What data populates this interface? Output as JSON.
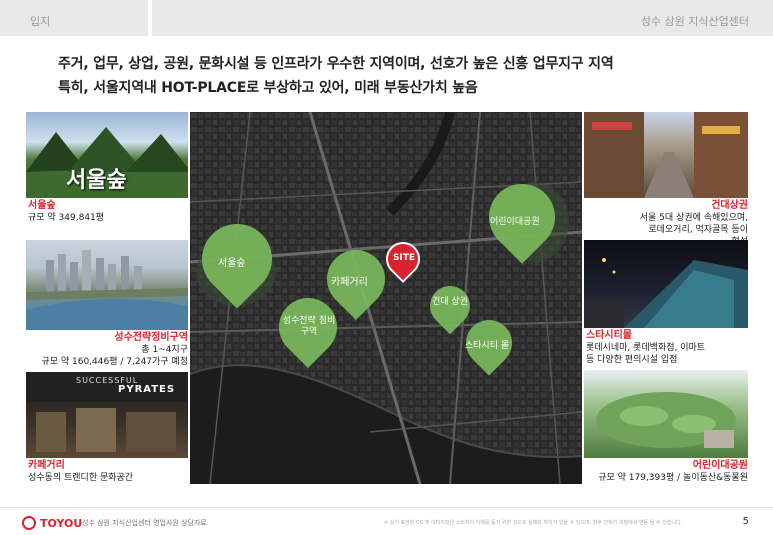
{
  "header": {
    "left_label": "입지",
    "right_label": "성수 삼원 지식산업센터"
  },
  "headline": {
    "line1": "주거, 업무, 상업, 공원, 문화시설 등 인프라가 우수한 지역이며, 선호가 높은 신흥 업무지구 지역",
    "line2": "특히, 서울지역내 HOT-PLACE로 부상하고 있어, 미래 부동산가치 높음"
  },
  "map": {
    "site_label": "SITE",
    "markers": [
      {
        "label": "서울숲"
      },
      {
        "label": "카페거리"
      },
      {
        "label": "성수전략 정비구역"
      },
      {
        "label": "어린이대공원"
      },
      {
        "label": "건대 상권"
      },
      {
        "label": "스타시티 몰"
      }
    ],
    "marker_color": "#79b85b",
    "site_color": "#d9232e"
  },
  "left_panels": [
    {
      "photo_text": "서울숲",
      "title": "서울숲",
      "desc": "규모 약 349,841평"
    },
    {
      "title": "성수전략정비구역",
      "desc1": "총 1~4지구",
      "desc2": "규모 약 160,446평 / 7,247가구 예정"
    },
    {
      "photo_text": "PYRATES",
      "photo_text2": "SUCCESSFUL",
      "title": "카페거리",
      "desc": "성수동의 트렌디한 문화공간"
    }
  ],
  "right_panels": [
    {
      "title": "건대상권",
      "desc1": "서울 5대 상권에 속해있으며,",
      "desc2": "로데오거리, 먹자골목 등이",
      "desc3": "형성"
    },
    {
      "title": "스타시티몰",
      "desc1": "롯데시네마, 롯데백화점, 이마트",
      "desc2": "등 다양한 편의시설 입점"
    },
    {
      "title": "어린이대공원",
      "desc": "규모 약 179,393평 / 놀이동산&동물원"
    }
  ],
  "footer": {
    "brand": "TOYOU",
    "text": "성수 삼원 지식산업센터 영업사원 상담자료",
    "note": "※ 상기 표현된 CG 및 이미지컷은 소비자의 이해를 돕기 위한 것으로 실제와 차이가 있을 수 있으며, 향후 인허가 과정에서 변동 될 수 있습니다.",
    "page": "5"
  },
  "colors": {
    "accent_red": "#d9232e",
    "marker_green": "#79b85b",
    "header_gray": "#e9e9e9"
  }
}
